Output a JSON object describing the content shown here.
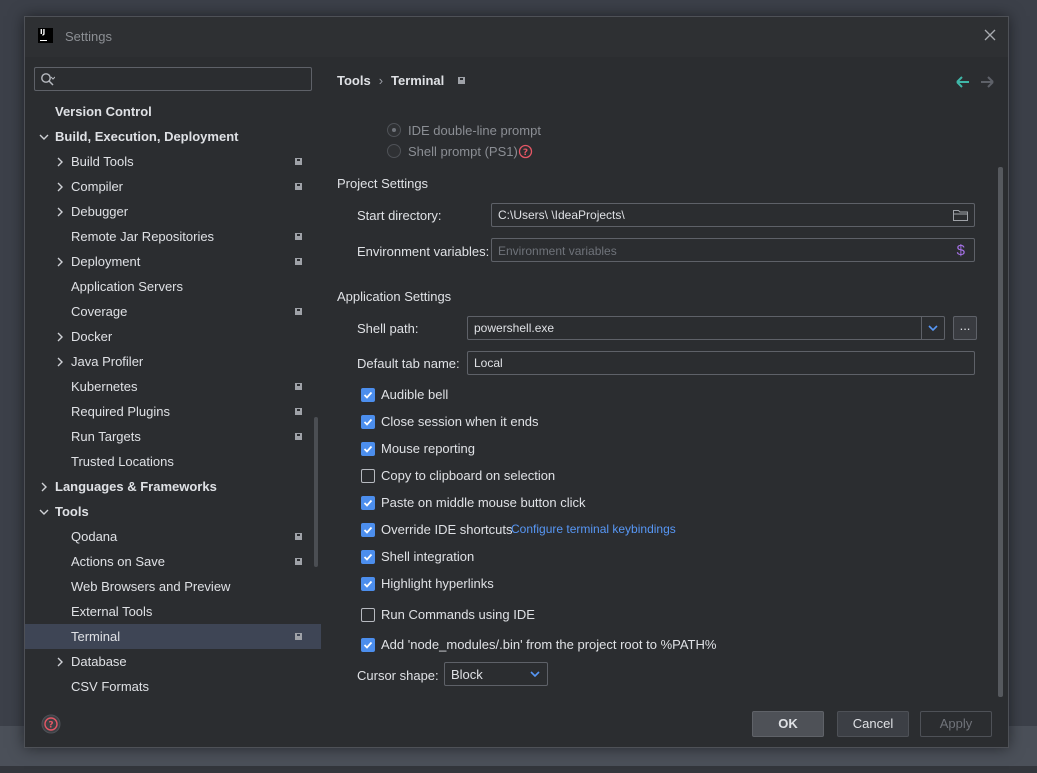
{
  "window": {
    "title": "Settings"
  },
  "search": {
    "placeholder": "",
    "value": ""
  },
  "sidebar": {
    "items": [
      {
        "label": "Version Control"
      },
      {
        "label": "Build, Execution, Deployment"
      },
      {
        "label": "Build Tools"
      },
      {
        "label": "Compiler"
      },
      {
        "label": "Debugger"
      },
      {
        "label": "Remote Jar Repositories"
      },
      {
        "label": "Deployment"
      },
      {
        "label": "Application Servers"
      },
      {
        "label": "Coverage"
      },
      {
        "label": "Docker"
      },
      {
        "label": "Java Profiler"
      },
      {
        "label": "Kubernetes"
      },
      {
        "label": "Required Plugins"
      },
      {
        "label": "Run Targets"
      },
      {
        "label": "Trusted Locations"
      },
      {
        "label": "Languages & Frameworks"
      },
      {
        "label": "Tools"
      },
      {
        "label": "Qodana"
      },
      {
        "label": "Actions on Save"
      },
      {
        "label": "Web Browsers and Preview"
      },
      {
        "label": "External Tools"
      },
      {
        "label": "Terminal"
      },
      {
        "label": "Database"
      },
      {
        "label": "CSV Formats"
      }
    ]
  },
  "breadcrumb": {
    "parent": "Tools",
    "current": "Terminal"
  },
  "prompt": {
    "ide_double_line": "IDE double-line prompt",
    "shell_prompt": "Shell prompt (PS1)"
  },
  "project_settings": {
    "title": "Project Settings",
    "start_directory_label": "Start directory:",
    "start_directory_value": "C:\\Users\\           \\IdeaProjects\\",
    "env_vars_label": "Environment variables:",
    "env_vars_placeholder": "Environment variables"
  },
  "application_settings": {
    "title": "Application Settings",
    "shell_path_label": "Shell path:",
    "shell_path_value": "powershell.exe",
    "ellipsis_label": "...",
    "tab_name_label": "Default tab name:",
    "tab_name_value": "Local"
  },
  "options": {
    "audible_bell": "Audible bell",
    "close_session": "Close session when it ends",
    "mouse_reporting": "Mouse reporting",
    "copy_clipboard": "Copy to clipboard on selection",
    "paste_middle": "Paste on middle mouse button click",
    "override_shortcuts": "Override IDE shortcuts",
    "configure_link": "Configure terminal keybindings",
    "shell_integration": "Shell integration",
    "highlight_hyperlinks": "Highlight hyperlinks",
    "run_commands": "Run Commands using IDE",
    "add_node_modules": "Add 'node_modules/.bin' from the project root to %PATH%"
  },
  "cursor": {
    "label": "Cursor shape:",
    "value": "Block"
  },
  "buttons": {
    "ok": "OK",
    "cancel": "Cancel",
    "apply": "Apply"
  },
  "colors": {
    "accent": "#4c8eed",
    "link": "#5797f5",
    "selection": "#3e4555",
    "help": "#e55765"
  }
}
